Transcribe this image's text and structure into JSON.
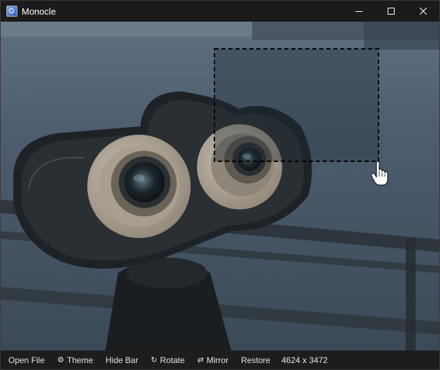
{
  "window": {
    "title": "Monocle",
    "icon": "monocle-app-icon"
  },
  "image": {
    "subject": "coin-operated binoculars",
    "selection_active": true
  },
  "cursor": {
    "icon": "hand-pointer-icon"
  },
  "toolbar": {
    "open_file": "Open File",
    "theme": "Theme",
    "hide_bar": "Hide Bar",
    "rotate": "Rotate",
    "mirror": "Mirror",
    "restore": "Restore",
    "dimensions": "4624 x 3472",
    "theme_icon": "gear-icon",
    "rotate_icon": "rotate-icon",
    "mirror_icon": "mirror-arrows-icon"
  },
  "colors": {
    "titlebar": "#1b1b1b",
    "statusbar": "#1d1d1d",
    "selection_border": "#000000"
  }
}
